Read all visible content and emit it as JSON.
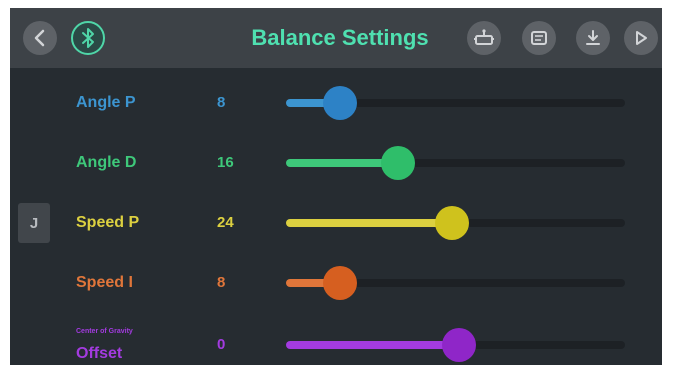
{
  "header": {
    "title": "Balance Settings",
    "icons": [
      "back-icon",
      "bluetooth-icon",
      "robot-icon",
      "document-icon",
      "download-icon",
      "play-icon"
    ]
  },
  "side_tab": {
    "label": "J"
  },
  "sliders": [
    {
      "label": "Angle P",
      "sublabel": "",
      "value": "8",
      "fraction": 0.16,
      "color": "#3c95d0",
      "knob_color": "#2d82c6"
    },
    {
      "label": "Angle D",
      "sublabel": "",
      "value": "16",
      "fraction": 0.33,
      "color": "#3ec87a",
      "knob_color": "#2fbe6a"
    },
    {
      "label": "Speed P",
      "sublabel": "",
      "value": "24",
      "fraction": 0.49,
      "color": "#dcd040",
      "knob_color": "#cfc21d"
    },
    {
      "label": "Speed I",
      "sublabel": "",
      "value": "8",
      "fraction": 0.16,
      "color": "#e0763a",
      "knob_color": "#d65f20"
    },
    {
      "label": "Offset",
      "sublabel": "Center of Gravity",
      "value": "0",
      "fraction": 0.51,
      "color": "#a33be0",
      "knob_color": "#8f26c8"
    }
  ]
}
